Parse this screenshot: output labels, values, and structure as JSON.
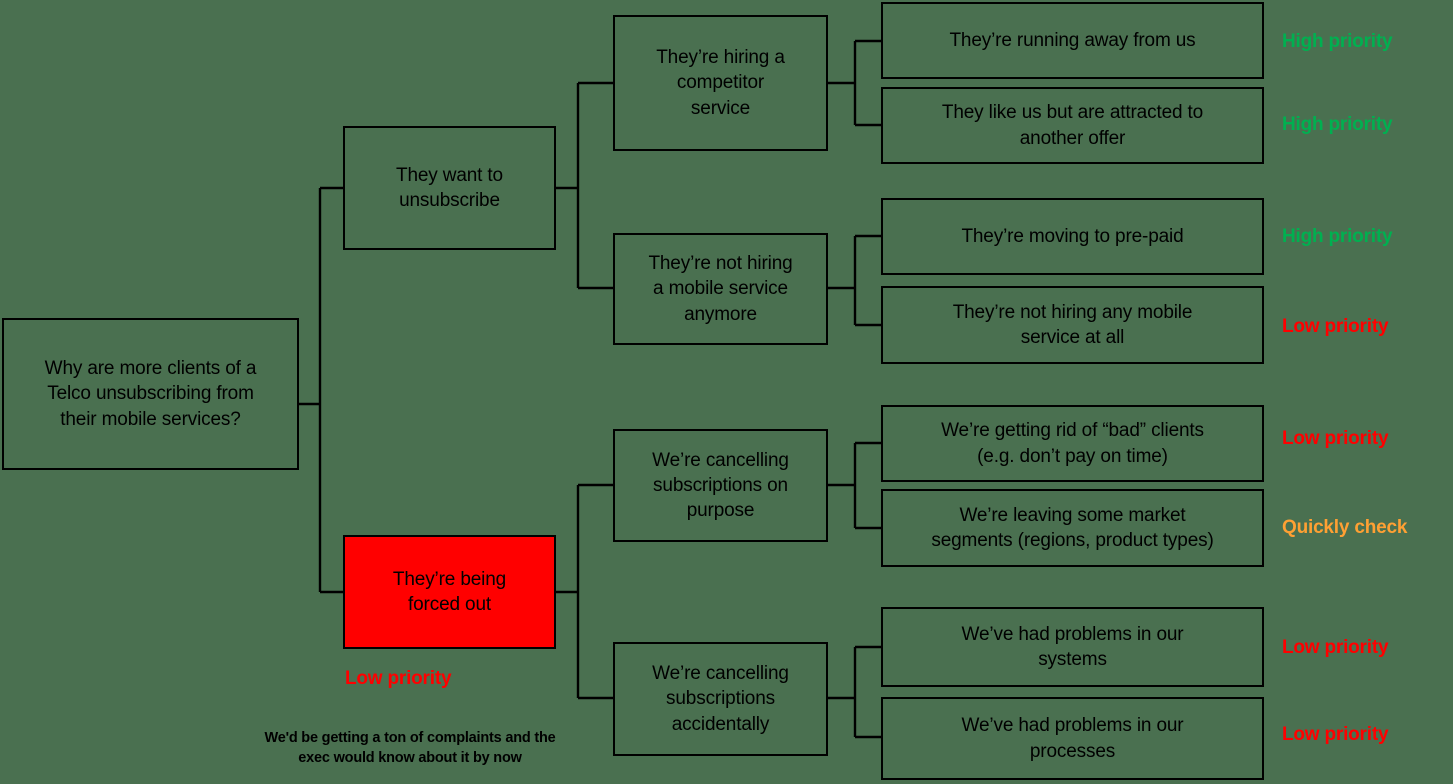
{
  "diagram": {
    "title": "Telco unsubscribe issue tree",
    "background_color": "#4a7050",
    "box_border_color": "#000000",
    "highlight_fill_color": "#ff0000"
  },
  "root": {
    "label": "Why are more clients of a\nTelco unsubscribing from\ntheir mobile services?"
  },
  "level2": [
    {
      "label": "They want to\nunsubscribe"
    },
    {
      "label": "They’re being\nforced out",
      "tag": "Low priority",
      "tag_color": "#ff0000",
      "highlighted": true
    }
  ],
  "level3": [
    {
      "label": "They’re hiring a\ncompetitor\nservice"
    },
    {
      "label": "They’re not hiring\na mobile service\nanymore"
    },
    {
      "label": "We’re cancelling\nsubscriptions on\npurpose"
    },
    {
      "label": "We’re cancelling\nsubscriptions\naccidentally"
    }
  ],
  "leaves": [
    {
      "label": "They’re running away from us",
      "tag": "High priority",
      "tag_class": "high"
    },
    {
      "label": "They like us but are attracted to\nanother offer",
      "tag": "High priority",
      "tag_class": "high"
    },
    {
      "label": "They’re moving to pre-paid",
      "tag": "High priority",
      "tag_class": "high"
    },
    {
      "label": "They’re not hiring any mobile\nservice at all",
      "tag": "Low priority",
      "tag_class": "low"
    },
    {
      "label": "We’re getting rid of “bad” clients\n(e.g. don’t pay on time)",
      "tag": "Low priority",
      "tag_class": "low"
    },
    {
      "label": "We’re leaving some market\nsegments (regions, product types)",
      "tag": "Quickly check",
      "tag_class": "check"
    },
    {
      "label": "We’ve had problems in our\nsystems",
      "tag": "Low priority",
      "tag_class": "low"
    },
    {
      "label": "We’ve had problems in our\nprocesses",
      "tag": "Low priority",
      "tag_class": "low"
    }
  ],
  "footnote": {
    "text": "We'd be getting a ton of complaints and the\nexec would know about it by now"
  }
}
